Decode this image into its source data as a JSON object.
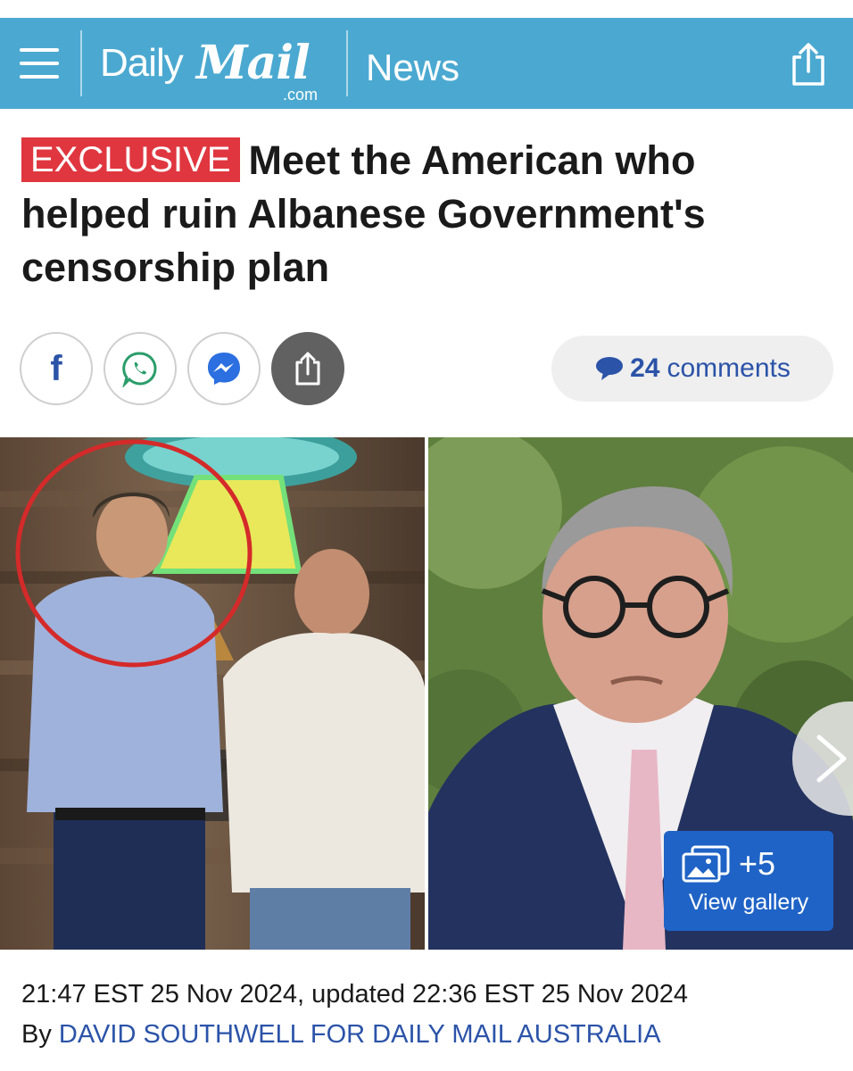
{
  "header": {
    "logo_daily": "Daily",
    "logo_mail": "Mail",
    "logo_com": ".com",
    "section": "News",
    "colors": {
      "bar": "#4ba9d1"
    }
  },
  "article": {
    "badge": "EXCLUSIVE",
    "headline": "Meet the American who helped ruin Albanese Government's censorship plan",
    "comments_count": "24",
    "comments_label": "comments",
    "gallery_count": "+5",
    "gallery_label": "View gallery",
    "timestamp": "21:47 EST 25 Nov 2024, updated 22:36 EST 25 Nov 2024",
    "byline_prefix": "By",
    "author": "DAVID SOUTHWELL FOR DAILY MAIL AUSTRALIA"
  },
  "social": {
    "icons": [
      "facebook-icon",
      "whatsapp-icon",
      "messenger-icon",
      "share-icon"
    ],
    "facebook_glyph": "f"
  },
  "colors": {
    "exclusive": "#e0363f",
    "link": "#2b53a8",
    "gallery": "#1f63c6"
  }
}
